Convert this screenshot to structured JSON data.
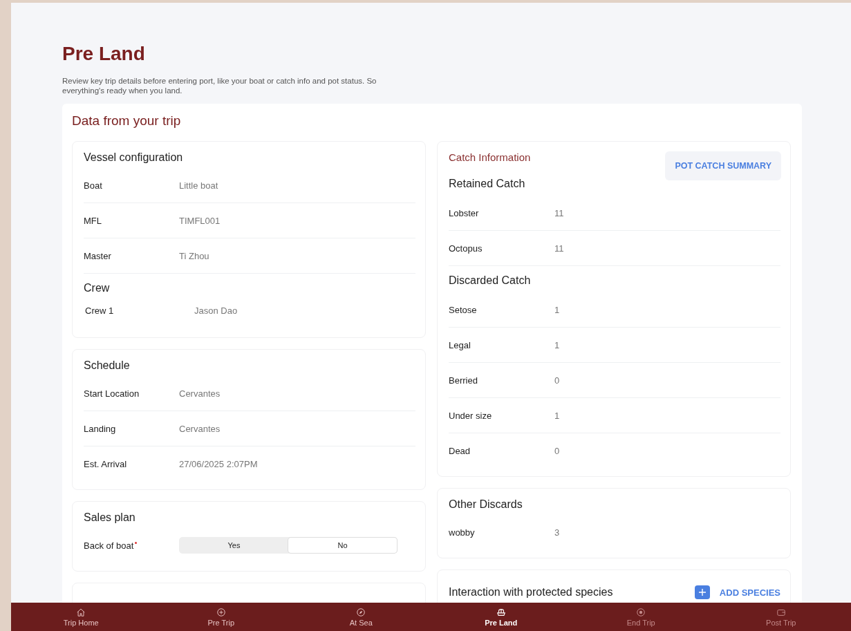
{
  "page": {
    "title": "Pre Land",
    "description": "Review key trip details before entering port, like your boat or catch info and pot status. So everything's ready when you land."
  },
  "trip_data": {
    "title": "Data from your trip",
    "left_cards": [
      {
        "title": "Vessel configuration",
        "items": [
          {
            "kind": "row",
            "label": "Boat",
            "value": "Little boat"
          },
          {
            "kind": "row",
            "label": "MFL",
            "value": "TIMFL001"
          },
          {
            "kind": "row",
            "label": "Master",
            "value": "Ti Zhou"
          },
          {
            "kind": "heading",
            "text": "Crew"
          },
          {
            "kind": "subrow",
            "label": "Crew 1",
            "value": "Jason Dao"
          }
        ]
      },
      {
        "title": "Schedule",
        "items": [
          {
            "kind": "row",
            "label": "Start Location",
            "value": "Cervantes"
          },
          {
            "kind": "row",
            "label": "Landing",
            "value": "Cervantes"
          },
          {
            "kind": "last",
            "label": "Est. Arrival",
            "value": "27/06/2025 2:07PM"
          }
        ]
      },
      {
        "title": "Sales plan",
        "items": [
          {
            "kind": "toggle",
            "label": "Back of boat",
            "required": true,
            "options": [
              {
                "label": "Yes",
                "selected": false
              },
              {
                "label": "No",
                "selected": true
              }
            ]
          }
        ]
      }
    ],
    "catch_information": {
      "title": "Catch Information",
      "button": "POT CATCH SUMMARY",
      "items": [
        {
          "kind": "heading",
          "text": "Retained Catch"
        },
        {
          "kind": "row",
          "label": "Lobster",
          "value": "11"
        },
        {
          "kind": "row",
          "label": "Octopus",
          "value": "11"
        },
        {
          "kind": "heading",
          "text": "Discarded Catch"
        },
        {
          "kind": "row",
          "label": "Setose",
          "value": "1"
        },
        {
          "kind": "row",
          "label": "Legal",
          "value": "1"
        },
        {
          "kind": "row",
          "label": "Berried",
          "value": "0"
        },
        {
          "kind": "row",
          "label": "Under size",
          "value": "1"
        },
        {
          "kind": "last",
          "label": "Dead",
          "value": "0"
        }
      ]
    },
    "other_discards": {
      "title": "Other Discards",
      "items": [
        {
          "kind": "last",
          "label": "wobby",
          "value": "3"
        }
      ]
    },
    "protected_species": {
      "title": "Interaction with protected species",
      "add_button": "ADD SPECIES"
    }
  },
  "bottom_nav": [
    {
      "label": "Trip Home",
      "selected": false,
      "disabled": false
    },
    {
      "label": "Pre Trip",
      "selected": false,
      "disabled": false
    },
    {
      "label": "At Sea",
      "selected": false,
      "disabled": false
    },
    {
      "label": "Pre Land",
      "selected": true,
      "disabled": false
    },
    {
      "label": "End Trip",
      "selected": false,
      "disabled": true
    },
    {
      "label": "Post Trip",
      "selected": false,
      "disabled": true
    }
  ]
}
